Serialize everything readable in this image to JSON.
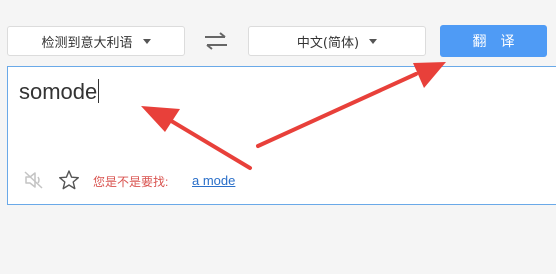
{
  "toolbar": {
    "source_language": "检测到意大利语",
    "target_language": "中文(简体)",
    "translate_label": "翻译"
  },
  "input": {
    "text": "somode"
  },
  "suggestion": {
    "prompt": "您是不是要找:",
    "link": "a mode"
  },
  "icons": {
    "swap": "swap-arrows-icon",
    "sound": "speaker-muted-icon",
    "favorite": "star-outline-icon",
    "dropdown": "chevron-down-icon"
  },
  "colors": {
    "accent": "#4f9bf5",
    "input_border": "#6aa9e8",
    "suggestion_prompt": "#d9534f",
    "link": "#2a6fc9",
    "annotation_arrow": "#e8403a"
  }
}
